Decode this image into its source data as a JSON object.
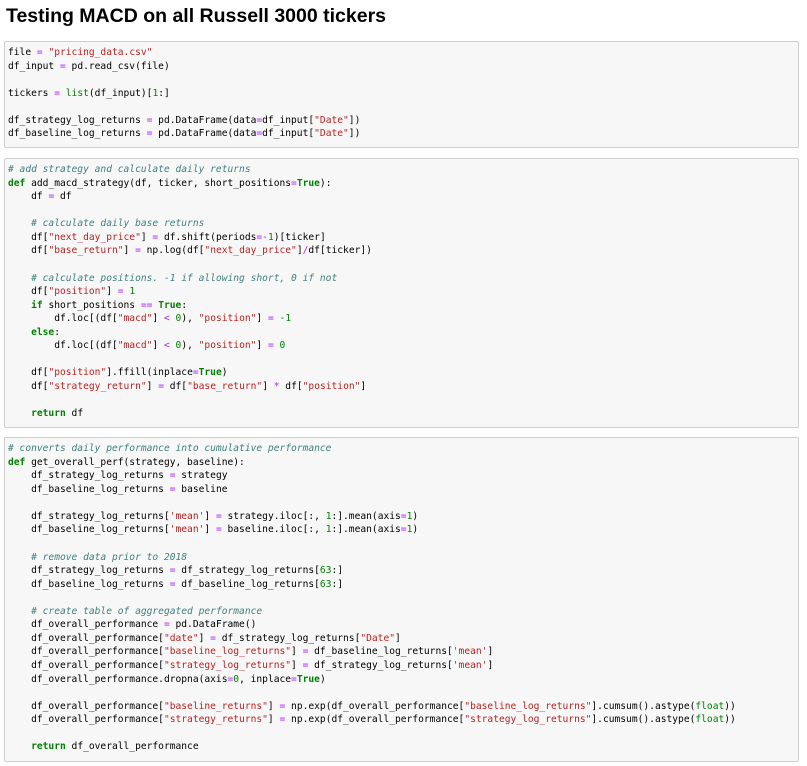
{
  "notebook": {
    "title": "Testing MACD on all Russell 3000 tickers"
  },
  "cells": [
    {
      "id": "cell-load-data",
      "lines": [
        [
          [
            "file ",
            "p"
          ],
          [
            "=",
            "op"
          ],
          [
            " ",
            "p"
          ],
          [
            "\"pricing_data.csv\"",
            "str"
          ]
        ],
        [
          [
            "df_input ",
            "p"
          ],
          [
            "=",
            "op"
          ],
          [
            " pd.read_csv(file)",
            "p"
          ]
        ],
        [],
        [
          [
            "tickers ",
            "p"
          ],
          [
            "=",
            "op"
          ],
          [
            " ",
            "p"
          ],
          [
            "list",
            "bi"
          ],
          [
            "(df_input)[",
            "p"
          ],
          [
            "1",
            "num"
          ],
          [
            ":]",
            "p"
          ]
        ],
        [],
        [
          [
            "df_strategy_log_returns ",
            "p"
          ],
          [
            "=",
            "op"
          ],
          [
            " pd.DataFrame(data",
            "p"
          ],
          [
            "=",
            "op"
          ],
          [
            "df_input[",
            "p"
          ],
          [
            "\"Date\"",
            "str"
          ],
          [
            "])",
            "p"
          ]
        ],
        [
          [
            "df_baseline_log_returns ",
            "p"
          ],
          [
            "=",
            "op"
          ],
          [
            " pd.DataFrame(data",
            "p"
          ],
          [
            "=",
            "op"
          ],
          [
            "df_input[",
            "p"
          ],
          [
            "\"Date\"",
            "str"
          ],
          [
            "])",
            "p"
          ]
        ]
      ]
    },
    {
      "id": "cell-add-macd-strategy",
      "lines": [
        [
          [
            "# add strategy and calculate daily returns",
            "cm"
          ]
        ],
        [
          [
            "def",
            "kw"
          ],
          [
            " add_macd_strategy(df, ticker, short_positions",
            "p"
          ],
          [
            "=",
            "op"
          ],
          [
            "True",
            "kw"
          ],
          [
            "):",
            "p"
          ]
        ],
        [
          [
            "    df ",
            "p"
          ],
          [
            "=",
            "op"
          ],
          [
            " df",
            "p"
          ]
        ],
        [],
        [
          [
            "    ",
            "p"
          ],
          [
            "# calculate daily base returns",
            "cm"
          ]
        ],
        [
          [
            "    df[",
            "p"
          ],
          [
            "\"next_day_price\"",
            "str"
          ],
          [
            "] ",
            "p"
          ],
          [
            "=",
            "op"
          ],
          [
            " df.shift(periods",
            "p"
          ],
          [
            "=-",
            "op"
          ],
          [
            "1",
            "num"
          ],
          [
            ")[ticker]",
            "p"
          ]
        ],
        [
          [
            "    df[",
            "p"
          ],
          [
            "\"base_return\"",
            "str"
          ],
          [
            "] ",
            "p"
          ],
          [
            "=",
            "op"
          ],
          [
            " np.log(df[",
            "p"
          ],
          [
            "\"next_day_price\"",
            "str"
          ],
          [
            "]",
            "p"
          ],
          [
            "/",
            "op"
          ],
          [
            "df[ticker])",
            "p"
          ]
        ],
        [],
        [
          [
            "    ",
            "p"
          ],
          [
            "# calculate positions. -1 if allowing short, 0 if not",
            "cm"
          ]
        ],
        [
          [
            "    df[",
            "p"
          ],
          [
            "\"position\"",
            "str"
          ],
          [
            "] ",
            "p"
          ],
          [
            "=",
            "op"
          ],
          [
            " ",
            "p"
          ],
          [
            "1",
            "num"
          ]
        ],
        [
          [
            "    ",
            "p"
          ],
          [
            "if",
            "kw"
          ],
          [
            " short_positions ",
            "p"
          ],
          [
            "==",
            "op"
          ],
          [
            " ",
            "p"
          ],
          [
            "True",
            "kw"
          ],
          [
            ":",
            "p"
          ]
        ],
        [
          [
            "        df.loc[(df[",
            "p"
          ],
          [
            "\"macd\"",
            "str"
          ],
          [
            "] ",
            "p"
          ],
          [
            "<",
            "op"
          ],
          [
            " ",
            "p"
          ],
          [
            "0",
            "num"
          ],
          [
            "), ",
            "p"
          ],
          [
            "\"position\"",
            "str"
          ],
          [
            "] ",
            "p"
          ],
          [
            "=",
            "op"
          ],
          [
            " ",
            "p"
          ],
          [
            "-1",
            "num"
          ]
        ],
        [
          [
            "    ",
            "p"
          ],
          [
            "else",
            "kw"
          ],
          [
            ":",
            "p"
          ]
        ],
        [
          [
            "        df.loc[(df[",
            "p"
          ],
          [
            "\"macd\"",
            "str"
          ],
          [
            "] ",
            "p"
          ],
          [
            "<",
            "op"
          ],
          [
            " ",
            "p"
          ],
          [
            "0",
            "num"
          ],
          [
            "), ",
            "p"
          ],
          [
            "\"position\"",
            "str"
          ],
          [
            "] ",
            "p"
          ],
          [
            "=",
            "op"
          ],
          [
            " ",
            "p"
          ],
          [
            "0",
            "num"
          ]
        ],
        [],
        [
          [
            "    df[",
            "p"
          ],
          [
            "\"position\"",
            "str"
          ],
          [
            "].ffill(inplace",
            "p"
          ],
          [
            "=",
            "op"
          ],
          [
            "True",
            "kw"
          ],
          [
            ")",
            "p"
          ]
        ],
        [
          [
            "    df[",
            "p"
          ],
          [
            "\"strategy_return\"",
            "str"
          ],
          [
            "] ",
            "p"
          ],
          [
            "=",
            "op"
          ],
          [
            " df[",
            "p"
          ],
          [
            "\"base_return\"",
            "str"
          ],
          [
            "] ",
            "p"
          ],
          [
            "*",
            "op"
          ],
          [
            " df[",
            "p"
          ],
          [
            "\"position\"",
            "str"
          ],
          [
            "]",
            "p"
          ]
        ],
        [],
        [
          [
            "    ",
            "p"
          ],
          [
            "return",
            "kw"
          ],
          [
            " df",
            "p"
          ]
        ]
      ]
    },
    {
      "id": "cell-get-overall-perf",
      "lines": [
        [
          [
            "# converts daily performance into cumulative performance",
            "cm"
          ]
        ],
        [
          [
            "def",
            "kw"
          ],
          [
            " get_overall_perf(strategy, baseline):",
            "p"
          ]
        ],
        [
          [
            "    df_strategy_log_returns ",
            "p"
          ],
          [
            "=",
            "op"
          ],
          [
            " strategy",
            "p"
          ]
        ],
        [
          [
            "    df_baseline_log_returns ",
            "p"
          ],
          [
            "=",
            "op"
          ],
          [
            " baseline",
            "p"
          ]
        ],
        [],
        [
          [
            "    df_strategy_log_returns[",
            "p"
          ],
          [
            "'mean'",
            "str"
          ],
          [
            "] ",
            "p"
          ],
          [
            "=",
            "op"
          ],
          [
            " strategy.iloc[:, ",
            "p"
          ],
          [
            "1",
            "num"
          ],
          [
            ":].mean(axis",
            "p"
          ],
          [
            "=",
            "op"
          ],
          [
            "1",
            "num"
          ],
          [
            ")",
            "p"
          ]
        ],
        [
          [
            "    df_baseline_log_returns[",
            "p"
          ],
          [
            "'mean'",
            "str"
          ],
          [
            "] ",
            "p"
          ],
          [
            "=",
            "op"
          ],
          [
            " baseline.iloc[:, ",
            "p"
          ],
          [
            "1",
            "num"
          ],
          [
            ":].mean(axis",
            "p"
          ],
          [
            "=",
            "op"
          ],
          [
            "1",
            "num"
          ],
          [
            ")",
            "p"
          ]
        ],
        [],
        [
          [
            "    ",
            "p"
          ],
          [
            "# remove data prior to 2018",
            "cm"
          ]
        ],
        [
          [
            "    df_strategy_log_returns ",
            "p"
          ],
          [
            "=",
            "op"
          ],
          [
            " df_strategy_log_returns[",
            "p"
          ],
          [
            "63",
            "num"
          ],
          [
            ":]",
            "p"
          ]
        ],
        [
          [
            "    df_baseline_log_returns ",
            "p"
          ],
          [
            "=",
            "op"
          ],
          [
            " df_baseline_log_returns[",
            "p"
          ],
          [
            "63",
            "num"
          ],
          [
            ":]",
            "p"
          ]
        ],
        [],
        [
          [
            "    ",
            "p"
          ],
          [
            "# create table of aggregated performance",
            "cm"
          ]
        ],
        [
          [
            "    df_overall_performance ",
            "p"
          ],
          [
            "=",
            "op"
          ],
          [
            " pd.DataFrame()",
            "p"
          ]
        ],
        [
          [
            "    df_overall_performance[",
            "p"
          ],
          [
            "\"date\"",
            "str"
          ],
          [
            "] ",
            "p"
          ],
          [
            "=",
            "op"
          ],
          [
            " df_strategy_log_returns[",
            "p"
          ],
          [
            "\"Date\"",
            "str"
          ],
          [
            "]",
            "p"
          ]
        ],
        [
          [
            "    df_overall_performance[",
            "p"
          ],
          [
            "\"baseline_log_returns\"",
            "str"
          ],
          [
            "] ",
            "p"
          ],
          [
            "=",
            "op"
          ],
          [
            " df_baseline_log_returns[",
            "p"
          ],
          [
            "'mean'",
            "str"
          ],
          [
            "]",
            "p"
          ]
        ],
        [
          [
            "    df_overall_performance[",
            "p"
          ],
          [
            "\"strategy_log_returns\"",
            "str"
          ],
          [
            "] ",
            "p"
          ],
          [
            "=",
            "op"
          ],
          [
            " df_strategy_log_returns[",
            "p"
          ],
          [
            "'mean'",
            "str"
          ],
          [
            "]",
            "p"
          ]
        ],
        [
          [
            "    df_overall_performance.dropna(axis",
            "p"
          ],
          [
            "=",
            "op"
          ],
          [
            "0",
            "num"
          ],
          [
            ", inplace",
            "p"
          ],
          [
            "=",
            "op"
          ],
          [
            "True",
            "kw"
          ],
          [
            ")",
            "p"
          ]
        ],
        [],
        [
          [
            "    df_overall_performance[",
            "p"
          ],
          [
            "\"baseline_returns\"",
            "str"
          ],
          [
            "] ",
            "p"
          ],
          [
            "=",
            "op"
          ],
          [
            " np.exp(df_overall_performance[",
            "p"
          ],
          [
            "\"baseline_log_returns\"",
            "str"
          ],
          [
            "].cumsum().astype(",
            "p"
          ],
          [
            "float",
            "bi"
          ],
          [
            "))",
            "p"
          ]
        ],
        [
          [
            "    df_overall_performance[",
            "p"
          ],
          [
            "\"strategy_returns\"",
            "str"
          ],
          [
            "] ",
            "p"
          ],
          [
            "=",
            "op"
          ],
          [
            " np.exp(df_overall_performance[",
            "p"
          ],
          [
            "\"strategy_log_returns\"",
            "str"
          ],
          [
            "].cumsum().astype(",
            "p"
          ],
          [
            "float",
            "bi"
          ],
          [
            "))",
            "p"
          ]
        ],
        [],
        [
          [
            "    ",
            "p"
          ],
          [
            "return",
            "kw"
          ],
          [
            " df_overall_performance",
            "p"
          ]
        ]
      ]
    }
  ]
}
